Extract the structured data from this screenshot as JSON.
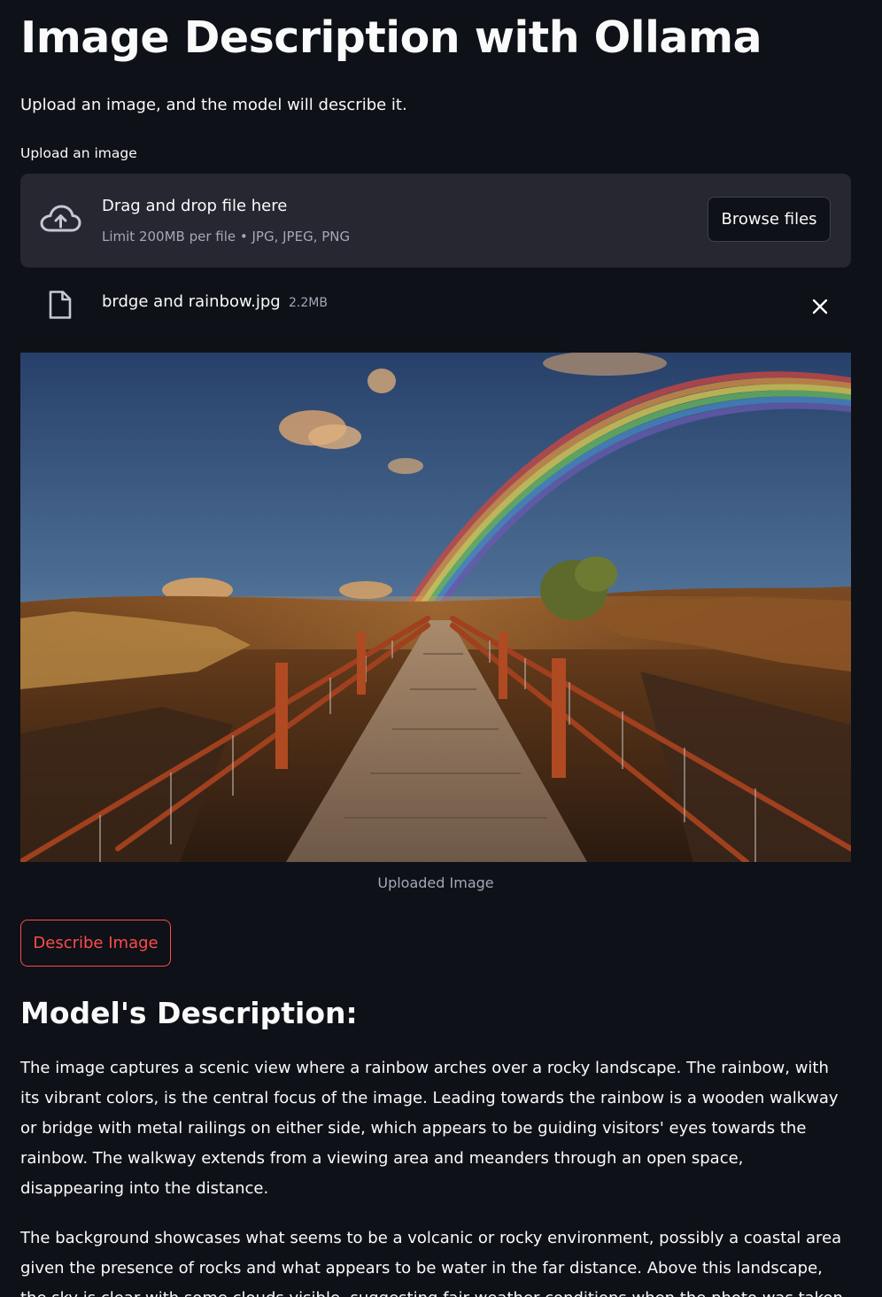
{
  "header": {
    "title": "Image Description with Ollama",
    "subtitle": "Upload an image, and the model will describe it."
  },
  "uploader": {
    "label": "Upload an image",
    "drop_title": "Drag and drop file here",
    "drop_hint": "Limit 200MB per file • JPG, JPEG, PNG",
    "browse_label": "Browse files",
    "icon": "cloud-upload-icon"
  },
  "uploaded_file": {
    "name": "brdge and rainbow.jpg",
    "size": "2.2MB",
    "icon": "file-icon",
    "remove_icon": "close-icon"
  },
  "image": {
    "caption": "Uploaded Image"
  },
  "actions": {
    "describe_label": "Describe Image"
  },
  "description": {
    "heading": "Model's Description:",
    "paragraphs": [
      "The image captures a scenic view where a rainbow arches over a rocky landscape. The rainbow, with its vibrant colors, is the central focus of the image. Leading towards the rainbow is a wooden walkway or bridge with metal railings on either side, which appears to be guiding visitors' eyes towards the rainbow. The walkway extends from a viewing area and meanders through an open space, disappearing into the distance.",
      "The background showcases what seems to be a volcanic or rocky environment, possibly a coastal area given the presence of rocks and what appears to be water in the far distance. Above this landscape, the sky is clear with some clouds visible, suggesting fair weather conditions when the photo was taken. The"
    ]
  },
  "colors": {
    "background": "#0e1117",
    "surface": "#262730",
    "text": "#fafafa",
    "muted_text": "#a3a8b8",
    "accent": "#ff4b4b"
  }
}
